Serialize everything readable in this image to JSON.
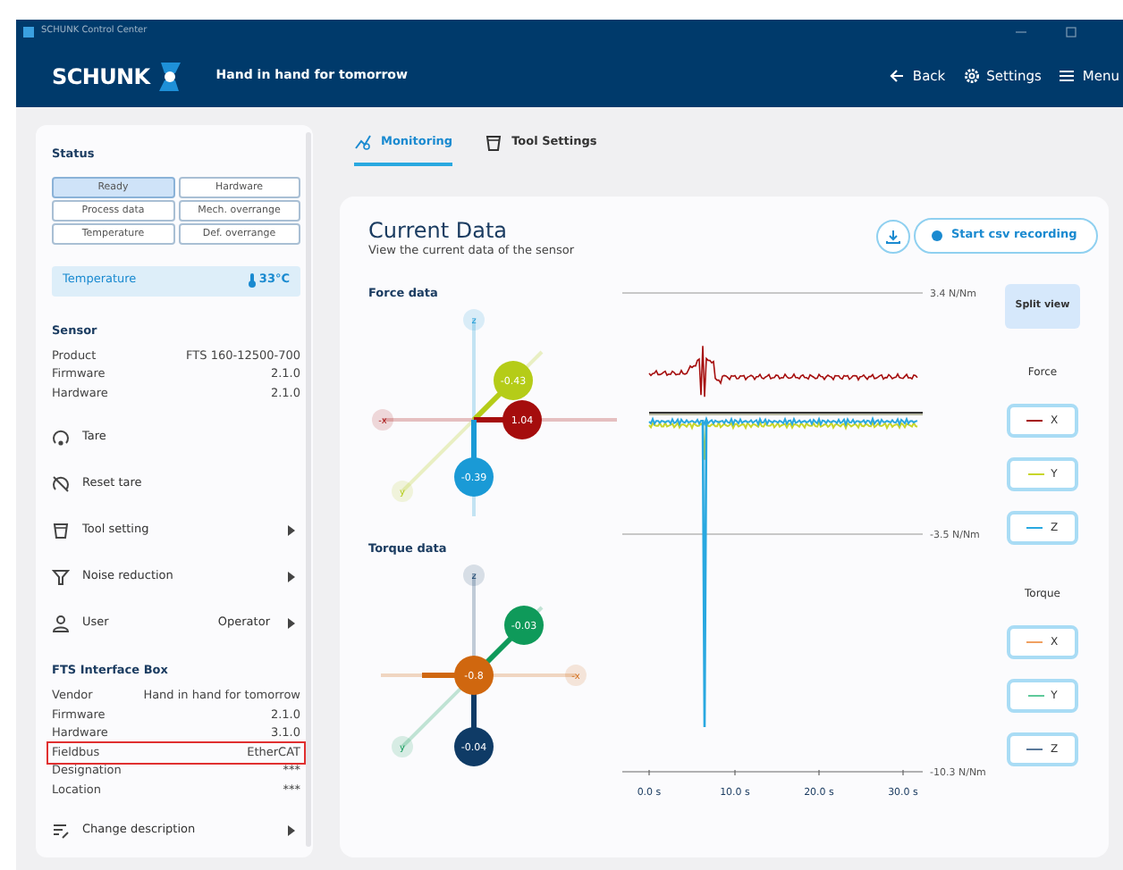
{
  "window": {
    "title": "SCHUNK Control Center"
  },
  "header": {
    "brand": "SCHUNK",
    "tagline": "Hand in hand for tomorrow",
    "actions": [
      {
        "label": "Back",
        "kind": "back"
      },
      {
        "label": "Settings",
        "kind": "settings"
      },
      {
        "label": "Menu",
        "kind": "menu"
      }
    ]
  },
  "sidebar": {
    "status": {
      "title": "Status",
      "flags": [
        {
          "label": "Ready",
          "active": true
        },
        {
          "label": "Hardware",
          "active": false
        },
        {
          "label": "Process data",
          "active": false
        },
        {
          "label": "Mech. overrange",
          "active": false
        },
        {
          "label": "Temperature",
          "active": false
        },
        {
          "label": "Def. overrange",
          "active": false
        }
      ]
    },
    "temperature": {
      "label": "Temperature",
      "value": "33°C"
    },
    "sensor": {
      "title": "Sensor",
      "rows": [
        {
          "label": "Product",
          "value": "FTS 160-12500-700",
          "highlighted": false
        },
        {
          "label": "Firmware",
          "value": "2.1.0",
          "highlighted": false
        },
        {
          "label": "Hardware",
          "value": "2.1.0",
          "highlighted": false
        }
      ]
    },
    "actions": [
      {
        "label": "Tare",
        "kind": "tare",
        "submenu": false
      },
      {
        "label": "Reset tare",
        "kind": "reset",
        "submenu": false
      },
      {
        "label": "Tool setting",
        "kind": "tool",
        "submenu": true
      },
      {
        "label": "Noise reduction",
        "kind": "filter",
        "submenu": true
      },
      {
        "label": "User",
        "kind": "user",
        "value": "Operator",
        "submenu": true
      }
    ],
    "interface_box": {
      "title": "FTS Interface Box",
      "rows": [
        {
          "label": "Vendor",
          "value": "Hand in hand for tomorrow",
          "highlighted": false
        },
        {
          "label": "Firmware",
          "value": "2.1.0",
          "highlighted": false
        },
        {
          "label": "Hardware",
          "value": "3.1.0",
          "highlighted": false
        },
        {
          "label": "Fieldbus",
          "value": "EtherCAT",
          "highlighted": true
        },
        {
          "label": "Designation",
          "value": "***",
          "highlighted": false
        },
        {
          "label": "Location",
          "value": "***",
          "highlighted": false
        }
      ]
    },
    "footer_action": {
      "label": "Change description",
      "submenu": true
    }
  },
  "tabs": [
    {
      "label": "Monitoring",
      "kind": "monitor",
      "selected": true
    },
    {
      "label": "Tool Settings",
      "kind": "tool",
      "selected": false
    }
  ],
  "panel": {
    "title": "Current Data",
    "subtitle": "View the current data of the sensor",
    "record_button": "Start csv recording",
    "diagrams": [
      {
        "kind": "force",
        "title": "Force data",
        "axis_labels": [
          {
            "kind": "z",
            "label": "z"
          },
          {
            "kind": "x",
            "label": "-x"
          },
          {
            "kind": "y",
            "label": "y"
          }
        ],
        "values": [
          {
            "kind": "y",
            "value": "-0.43",
            "color": "#b5cc18"
          },
          {
            "kind": "x",
            "value": "1.04",
            "color": "#a50d0d"
          },
          {
            "kind": "z",
            "value": "-0.39",
            "color": "#1a9ad6"
          }
        ]
      },
      {
        "kind": "torque",
        "title": "Torque data",
        "axis_labels": [
          {
            "kind": "z",
            "label": "z"
          },
          {
            "kind": "x",
            "label": "-x"
          },
          {
            "kind": "y",
            "label": "y"
          }
        ],
        "values": [
          {
            "kind": "y",
            "value": "-0.03",
            "color": "#0f9a5a"
          },
          {
            "kind": "x",
            "value": "-0.8",
            "color": "#d0670f"
          },
          {
            "kind": "z",
            "value": "-0.04",
            "color": "#0f3b66"
          }
        ]
      }
    ],
    "plot": {
      "y_labels": [
        "3.4 N/Nm",
        "-3.5 N/Nm",
        "-10.3 N/Nm"
      ],
      "x_labels": [
        "0.0 s",
        "10.0 s",
        "20.0 s",
        "30.0 s"
      ]
    },
    "split_view": {
      "label": "Split view",
      "selected": true
    },
    "legend_groups": [
      {
        "title": "Force",
        "items": [
          {
            "label": "X",
            "color": "#a50d0d"
          },
          {
            "label": "Y",
            "color": "#c8d62a"
          },
          {
            "label": "Z",
            "color": "#29a8e0"
          }
        ]
      },
      {
        "title": "Torque",
        "items": [
          {
            "label": "X",
            "color": "#f0a060"
          },
          {
            "label": "Y",
            "color": "#5ec99a"
          },
          {
            "label": "Z",
            "color": "#5a7a9a"
          }
        ]
      }
    ]
  }
}
